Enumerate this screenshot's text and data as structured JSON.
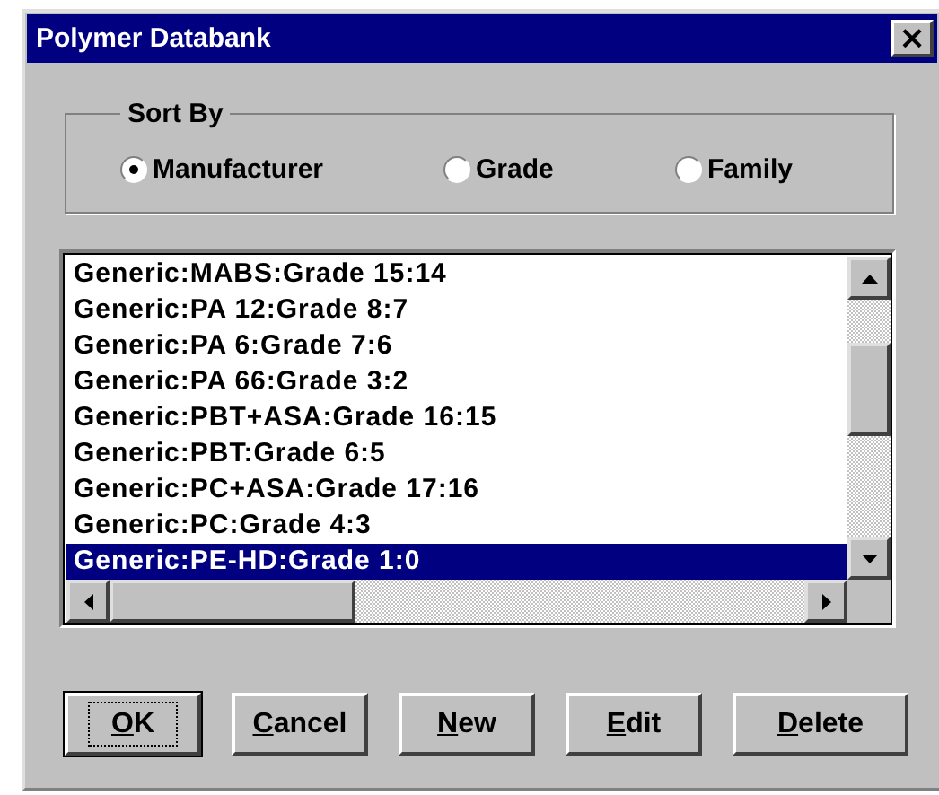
{
  "window": {
    "title": "Polymer Databank",
    "close": "×"
  },
  "sort_by": {
    "label": "Sort By",
    "options": [
      {
        "label": "Manufacturer",
        "selected": true
      },
      {
        "label": "Grade",
        "selected": false
      },
      {
        "label": "Family",
        "selected": false
      }
    ]
  },
  "list": {
    "items": [
      {
        "text": "Generic:MABS:Grade 15:14",
        "selected": false
      },
      {
        "text": "Generic:PA 12:Grade 8:7",
        "selected": false
      },
      {
        "text": "Generic:PA 6:Grade 7:6",
        "selected": false
      },
      {
        "text": "Generic:PA 66:Grade 3:2",
        "selected": false
      },
      {
        "text": "Generic:PBT+ASA:Grade 16:15",
        "selected": false
      },
      {
        "text": "Generic:PBT:Grade 6:5",
        "selected": false
      },
      {
        "text": "Generic:PC+ASA:Grade 17:16",
        "selected": false
      },
      {
        "text": "Generic:PC:Grade 4:3",
        "selected": false
      },
      {
        "text": "Generic:PE-HD:Grade 1:0",
        "selected": true
      }
    ]
  },
  "buttons": [
    {
      "label": "OK",
      "default": true
    },
    {
      "label": "Cancel",
      "default": false
    },
    {
      "label": "New",
      "default": false
    },
    {
      "label": "Edit",
      "default": false
    },
    {
      "label": "Delete",
      "default": false
    }
  ]
}
